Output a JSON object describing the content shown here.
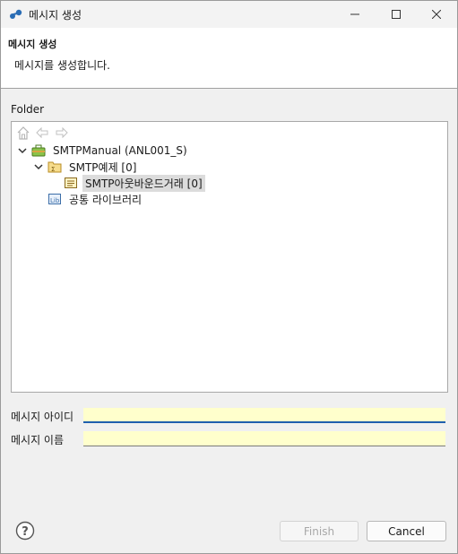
{
  "window": {
    "title": "메시지 생성"
  },
  "header": {
    "title": "메시지 생성",
    "description": "메시지를 생성합니다."
  },
  "folder": {
    "label": "Folder",
    "nav_icons": [
      "home-icon",
      "back-arrow-icon",
      "forward-arrow-icon"
    ],
    "tree": [
      {
        "label": "SMTPManual  (ANL001_S)",
        "icon": "project-icon",
        "expanded": true
      },
      {
        "label": "SMTP예제 [0]",
        "icon": "package-folder-icon",
        "expanded": true
      },
      {
        "label": "SMTP아웃바운드거래 [0]",
        "icon": "transaction-icon",
        "selected": true
      },
      {
        "label": "공통 라이브러리",
        "icon": "library-icon"
      }
    ]
  },
  "form": {
    "message_id": {
      "label": "메시지 아이디",
      "value": ""
    },
    "message_name": {
      "label": "메시지 이름",
      "value": ""
    }
  },
  "buttons": {
    "finish": "Finish",
    "cancel": "Cancel",
    "help": "help-icon"
  },
  "colors": {
    "input_bg": "#ffffcc",
    "focus": "#1f5fae",
    "selection": "#dcdcdc"
  }
}
